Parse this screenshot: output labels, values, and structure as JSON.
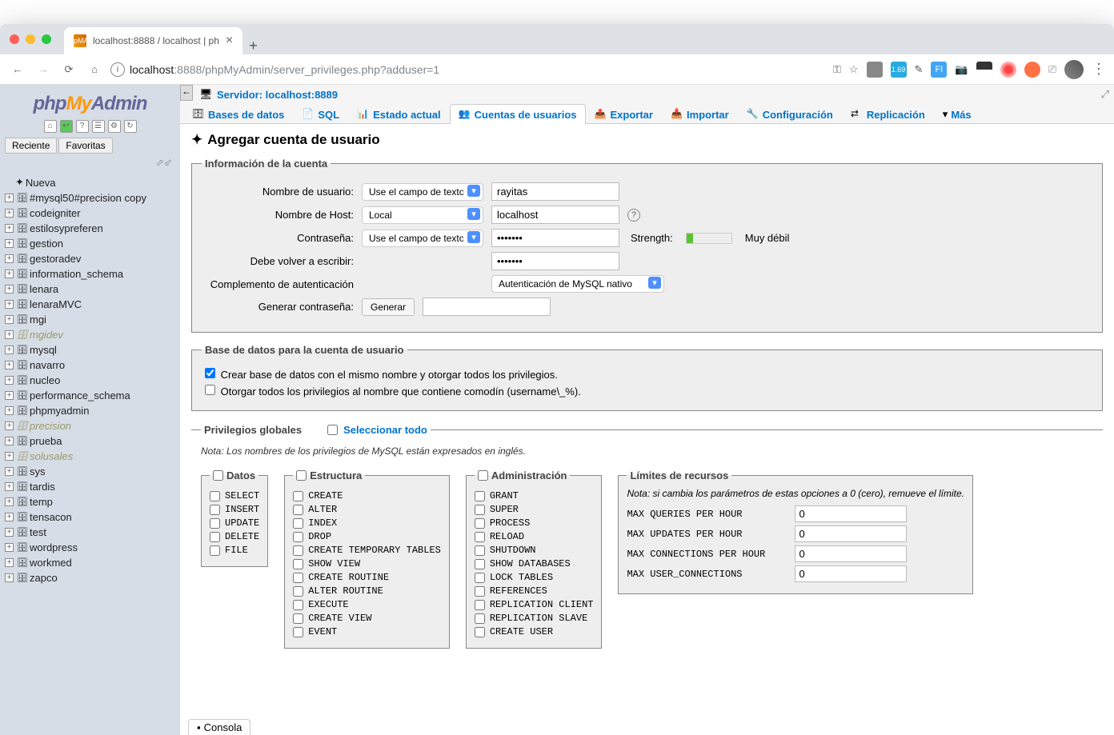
{
  "browser": {
    "tab_title": "localhost:8888 / localhost | ph",
    "url_host": "localhost",
    "url_port": ":8888",
    "url_path": "/phpMyAdmin/server_privileges.php?adduser=1"
  },
  "logo": {
    "p1": "php",
    "p2": "My",
    "p3": "Admin"
  },
  "sidebar": {
    "recent": "Reciente",
    "favorites": "Favoritas",
    "new": "Nueva",
    "databases": [
      "#mysql50#precision copy",
      "codeigniter",
      "estilosypreferen",
      "gestion",
      "gestoradev",
      "information_schema",
      "lenara",
      "lenaraMVC",
      "mgi",
      "mgidev",
      "mysql",
      "navarro",
      "nucleo",
      "performance_schema",
      "phpmyadmin",
      "precision",
      "prueba",
      "solusales",
      "sys",
      "tardis",
      "temp",
      "tensacon",
      "test",
      "wordpress",
      "workmed",
      "zapco"
    ],
    "highlighted": [
      "mgidev",
      "precision",
      "solusales"
    ]
  },
  "breadcrumb": {
    "server_label": "Servidor: localhost:8889"
  },
  "tabs": {
    "databases": "Bases de datos",
    "sql": "SQL",
    "status": "Estado actual",
    "users": "Cuentas de usuarios",
    "export": "Exportar",
    "import": "Importar",
    "settings": "Configuración",
    "replication": "Replicación",
    "more": "Más"
  },
  "page": {
    "title": "Agregar cuenta de usuario",
    "fieldset_account": "Información de la cuenta",
    "username_label": "Nombre de usuario:",
    "username_select": "Use el campo de texto:",
    "username_value": "rayitas",
    "hostname_label": "Nombre de Host:",
    "hostname_select": "Local",
    "hostname_value": "localhost",
    "password_label": "Contraseña:",
    "password_select": "Use el campo de texto:",
    "password_value": "•••••••",
    "strength_label": "Strength:",
    "strength_text": "Muy débil",
    "retype_label": "Debe volver a escribir:",
    "retype_value": "•••••••",
    "authplugin_label": "Complemento de autenticación",
    "authplugin_value": "Autenticación de MySQL nativo",
    "genpass_label": "Generar contraseña:",
    "genpass_button": "Generar",
    "fieldset_db": "Base de datos para la cuenta de usuario",
    "db_opt1": "Crear base de datos con el mismo nombre y otorgar todos los privilegios.",
    "db_opt2": "Otorgar todos los privilegios al nombre que contiene comodín (username\\_%).",
    "fieldset_priv": "Privilegios globales",
    "select_all": "Seleccionar todo",
    "priv_note": "Nota: Los nombres de los privilegios de MySQL están expresados en inglés.",
    "group_data": "Datos",
    "group_struct": "Estructura",
    "group_admin": "Administración",
    "group_limits": "Límites de recursos",
    "priv_data": [
      "SELECT",
      "INSERT",
      "UPDATE",
      "DELETE",
      "FILE"
    ],
    "priv_struct": [
      "CREATE",
      "ALTER",
      "INDEX",
      "DROP",
      "CREATE TEMPORARY TABLES",
      "SHOW VIEW",
      "CREATE ROUTINE",
      "ALTER ROUTINE",
      "EXECUTE",
      "CREATE VIEW",
      "EVENT"
    ],
    "priv_admin": [
      "GRANT",
      "SUPER",
      "PROCESS",
      "RELOAD",
      "SHUTDOWN",
      "SHOW DATABASES",
      "LOCK TABLES",
      "REFERENCES",
      "REPLICATION CLIENT",
      "REPLICATION SLAVE",
      "CREATE USER"
    ],
    "limits_note": "Nota: si cambia los parámetros de estas opciones a 0 (cero), remueve el límite.",
    "lim1": "MAX QUERIES PER HOUR",
    "lim2": "MAX UPDATES PER HOUR",
    "lim3": "MAX CONNECTIONS PER HOUR",
    "lim4": "MAX USER_CONNECTIONS",
    "lim_val": "0",
    "console": "Consola"
  }
}
